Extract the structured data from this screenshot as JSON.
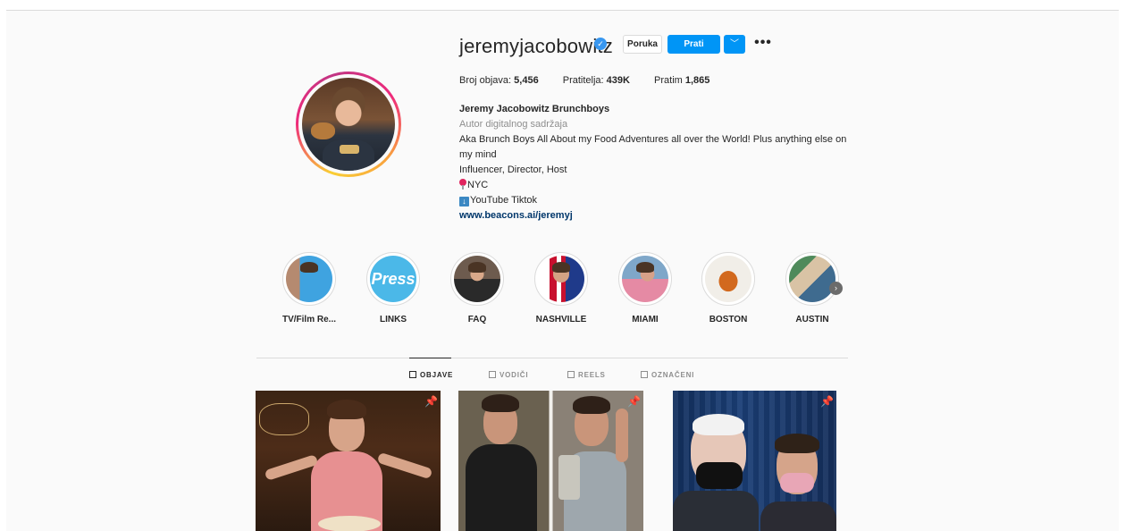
{
  "profile": {
    "username": "jeremyjacobowitz",
    "verified_glyph": "✓",
    "buttons": {
      "message": "Poruka",
      "follow": "Prati",
      "suggest_glyph": "﹀",
      "more_glyph": "•••"
    },
    "stats": {
      "posts_label": "Broj objava:",
      "posts_value": "5,456",
      "followers_label": "Pratitelja:",
      "followers_value": "439K",
      "following_label": "Pratim",
      "following_value": "1,865"
    },
    "bio": {
      "full_name": "Jeremy Jacobowitz Brunchboys",
      "category": "Autor digitalnog sadržaja",
      "line1": "Aka Brunch Boys All About my Food Adventures all over the World! Plus anything else on my mind",
      "line2": "Influencer, Director, Host",
      "line3": "NYC",
      "line4": "YouTube Tiktok",
      "link": "www.beacons.ai/jeremyj"
    }
  },
  "highlights": [
    {
      "label": "TV/Film Re..."
    },
    {
      "label": "LINKS",
      "thumb_text": "Press"
    },
    {
      "label": "FAQ"
    },
    {
      "label": "NASHVILLE"
    },
    {
      "label": "MIAMI"
    },
    {
      "label": "BOSTON"
    },
    {
      "label": "AUSTIN"
    }
  ],
  "highlights_next_glyph": "›",
  "tabs": [
    {
      "label": "OBJAVE",
      "active": true
    },
    {
      "label": "VODIČI",
      "active": false
    },
    {
      "label": "REELS",
      "active": false
    },
    {
      "label": "OZNAČENI",
      "active": false
    }
  ],
  "posts": [
    {
      "pinned": true,
      "pin_glyph": "📌"
    },
    {
      "pinned": true,
      "pin_glyph": "📌"
    },
    {
      "pinned": true,
      "pin_glyph": "📌"
    }
  ],
  "colors": {
    "accent": "#0095f6",
    "verified": "#3897f0",
    "link": "#00376b"
  }
}
